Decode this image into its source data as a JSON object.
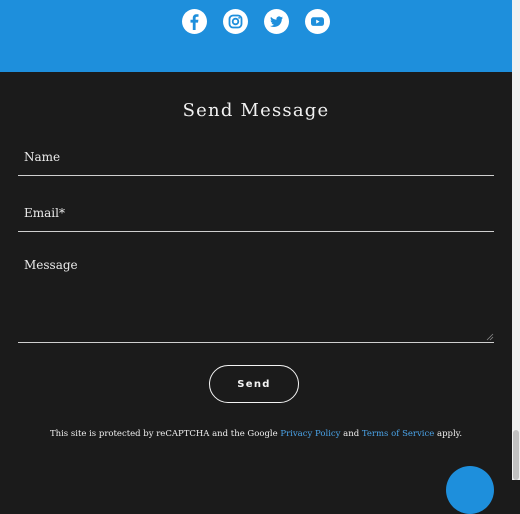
{
  "social": {
    "icons": [
      "facebook-icon",
      "instagram-icon",
      "twitter-icon",
      "youtube-icon"
    ],
    "bar_color": "#1e8fdc"
  },
  "form": {
    "title": "Send Message",
    "name_label": "Name",
    "email_label": "Email*",
    "message_label": "Message",
    "send_label": "Send"
  },
  "recaptcha": {
    "prefix": "This site is protected by reCAPTCHA and the Google ",
    "privacy_link": "Privacy Policy",
    "middle": " and ",
    "terms_link": "Terms of Service",
    "suffix": " apply."
  },
  "colors": {
    "background": "#1b1b1b",
    "accent": "#1e8fdc",
    "link": "#4aa3e8"
  }
}
